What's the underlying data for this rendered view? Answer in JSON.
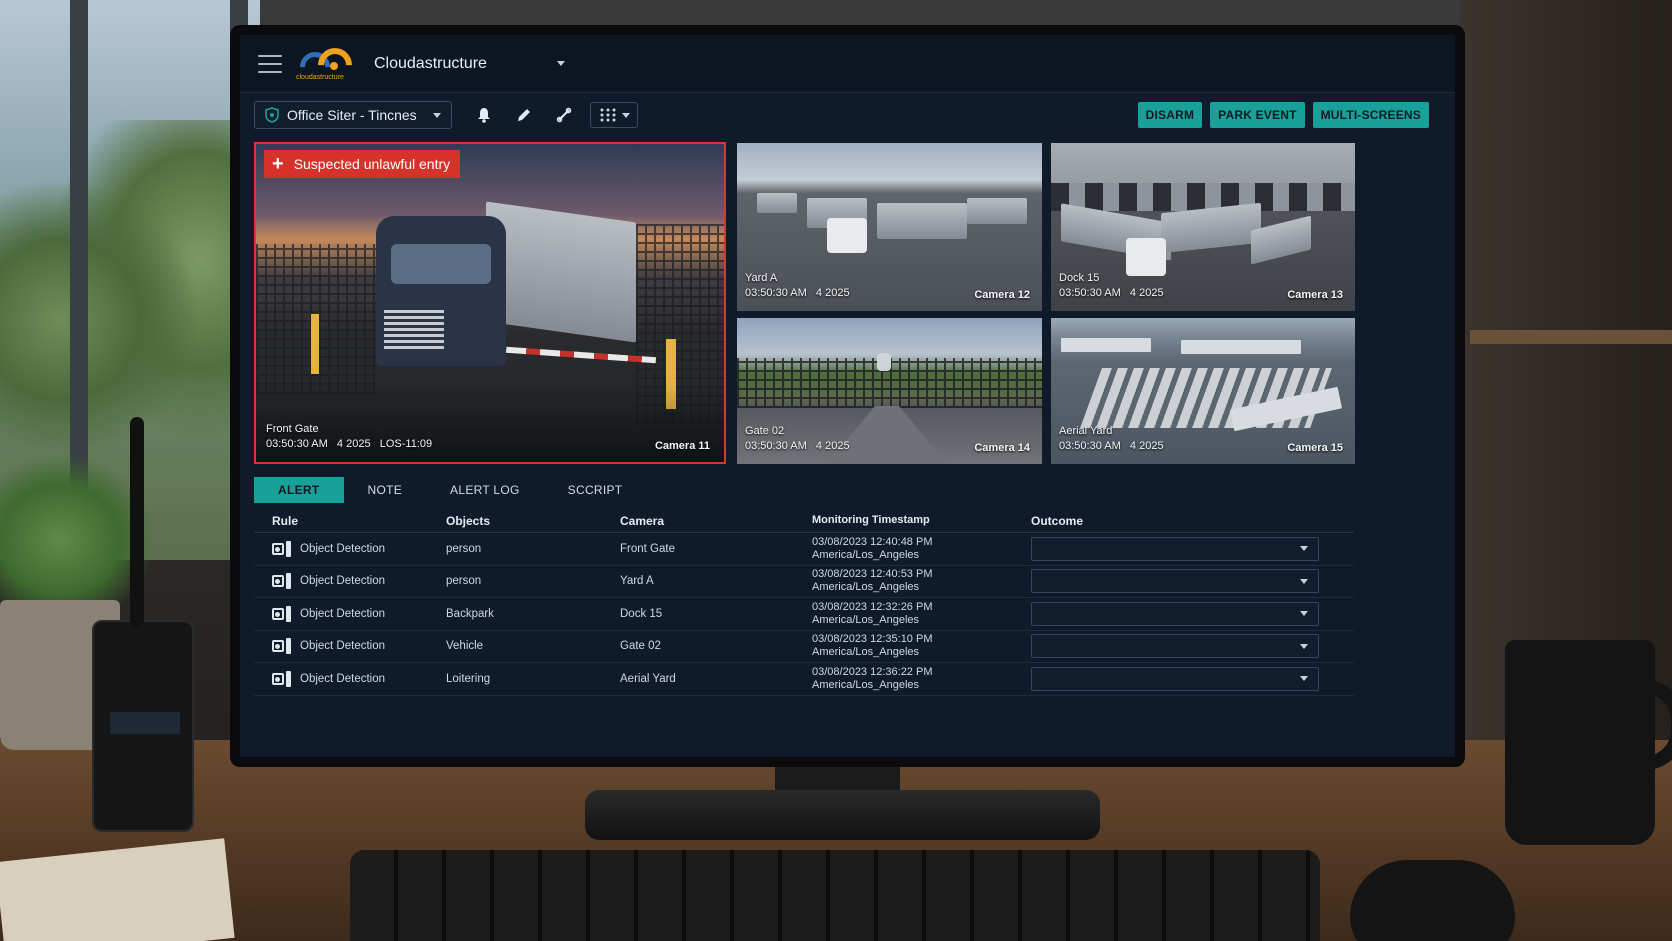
{
  "app": {
    "name": "Cloudastructure",
    "logo_text": "cloudastructure"
  },
  "toolbar": {
    "site_label": "Office Siter - Tincnes",
    "icons": [
      "shield-icon",
      "bell-icon",
      "pencil-icon",
      "link-icon",
      "grid-layout-icon"
    ],
    "buttons": {
      "disarm": "DISARM",
      "park_event": "PARK EVENT",
      "multi_screens": "MULTI-SCREENS"
    }
  },
  "colors": {
    "accent": "#19a199",
    "alert": "#d4322b",
    "background": "#0f1b2a"
  },
  "cameras": {
    "main": {
      "alert": "Suspected unlawful entry",
      "name": "Front Gate",
      "timestamp": "03:50:30 AM   4 2025   LOS-11:09",
      "camera": "Camera 11"
    },
    "c12": {
      "name": "Yard A",
      "timestamp": "03:50:30 AM   4 2025",
      "camera": "Camera 12"
    },
    "c13": {
      "name": "Dock 15",
      "timestamp": "03:50:30 AM   4 2025",
      "camera": "Camera 13"
    },
    "c14": {
      "name": "Gate 02",
      "timestamp": "03:50:30 AM   4 2025",
      "camera": "Camera 14"
    },
    "c15": {
      "name": "Aerial Yard",
      "timestamp": "03:50:30 AM   4 2025",
      "camera": "Camera 15"
    }
  },
  "tabs": {
    "alert": "ALERT",
    "note": "NOTE",
    "alert_log": "ALERT LOG",
    "script": "SCCRIPT"
  },
  "table": {
    "headers": {
      "rule": "Rule",
      "objects": "Objects",
      "camera": "Camera",
      "timestamp": "Monitoring Timestamp",
      "outcome": "Outcome"
    },
    "rows": [
      {
        "rule": "Object Detection",
        "objects": "person",
        "camera": "Front Gate",
        "ts_date": "03/08/2023 12:40:48 PM",
        "ts_zone": "America/Los_Angeles"
      },
      {
        "rule": "Object Detection",
        "objects": "person",
        "camera": "Yard A",
        "ts_date": "03/08/2023 12:40:53 PM",
        "ts_zone": "America/Los_Angeles"
      },
      {
        "rule": "Object Detection",
        "objects": "Backpark",
        "camera": "Dock 15",
        "ts_date": "03/08/2023 12:32:26 PM",
        "ts_zone": "America/Los_Angeles"
      },
      {
        "rule": "Object Detection",
        "objects": "Vehicle",
        "camera": "Gate 02",
        "ts_date": "03/08/2023 12:35:10 PM",
        "ts_zone": "America/Los_Angeles"
      },
      {
        "rule": "Object Detection",
        "objects": "Loitering",
        "camera": "Aerial Yard",
        "ts_date": "03/08/2023 12:36:22 PM",
        "ts_zone": "America/Los_Angeles"
      }
    ]
  }
}
